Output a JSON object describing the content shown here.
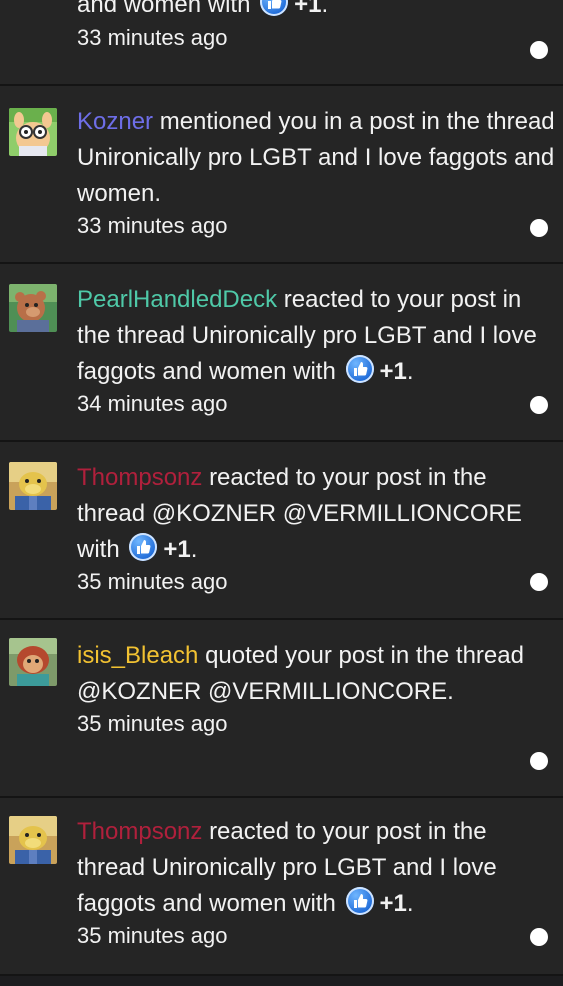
{
  "colors": {
    "background": "#252525",
    "divider": "#141414",
    "text": "#f2f2f2",
    "kozner": "#6e6ee8",
    "pearl": "#4fc9a8",
    "thompsonz": "#b0203c",
    "isis": "#f2c232"
  },
  "items": [
    {
      "line1_text": "and women with",
      "reaction": "+1",
      "tail": ".",
      "time": "33 minutes ago"
    },
    {
      "user": "Kozner",
      "text": "mentioned you in a post in the thread Unironically pro LGBT and I love faggots and women.",
      "time": "33 minutes ago",
      "avatar": "arthur-aardvark-avatar"
    },
    {
      "user": "PearlHandledDeck",
      "text": "reacted to your post in the thread Unironically pro LGBT and I love faggots and women with",
      "reaction": "+1",
      "tail": ".",
      "time": "34 minutes ago",
      "avatar": "bear-character-avatar"
    },
    {
      "user": "Thompsonz",
      "text": "reacted to your post in the thread @KOZNER @VERMILLIONCORE with",
      "reaction": "+1",
      "tail": ".",
      "time": "35 minutes ago",
      "avatar": "binky-character-avatar"
    },
    {
      "user": "isis_Bleach",
      "text": "quoted your post in the thread @KOZNER @VERMILLIONCORE.",
      "time": "35 minutes ago",
      "avatar": "muffy-character-avatar"
    },
    {
      "user": "Thompsonz",
      "text": "reacted to your post in the thread Unironically pro LGBT and I love faggots and women with",
      "reaction": "+1",
      "tail": ".",
      "time": "35 minutes ago",
      "avatar": "binky-character-avatar"
    }
  ]
}
